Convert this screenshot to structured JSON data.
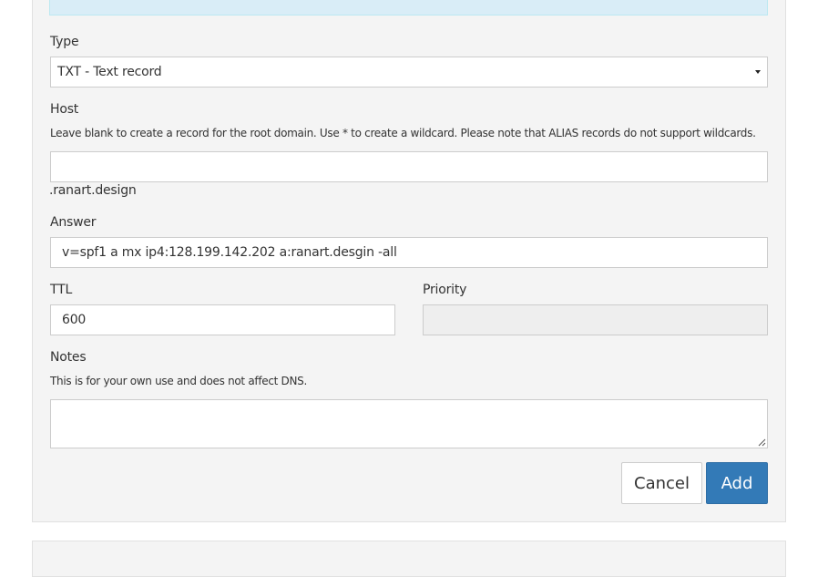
{
  "form": {
    "type": {
      "label": "Type",
      "selected": "TXT - Text record"
    },
    "host": {
      "label": "Host",
      "help": "Leave blank to create a record for the root domain. Use * to create a wildcard. Please note that ALIAS records do not support wildcards.",
      "value": "",
      "suffix": ".ranart.design"
    },
    "answer": {
      "label": "Answer",
      "value": "v=spf1 a mx ip4:128.199.142.202 a:ranart.desgin -all"
    },
    "ttl": {
      "label": "TTL",
      "value": "600"
    },
    "priority": {
      "label": "Priority",
      "value": ""
    },
    "notes": {
      "label": "Notes",
      "help": "This is for your own use and does not affect DNS.",
      "value": ""
    }
  },
  "buttons": {
    "cancel": "Cancel",
    "add": "Add"
  },
  "colors": {
    "primary": "#337ab7",
    "info_bg": "#d9edf7",
    "panel_bg": "#f4f4f4"
  }
}
